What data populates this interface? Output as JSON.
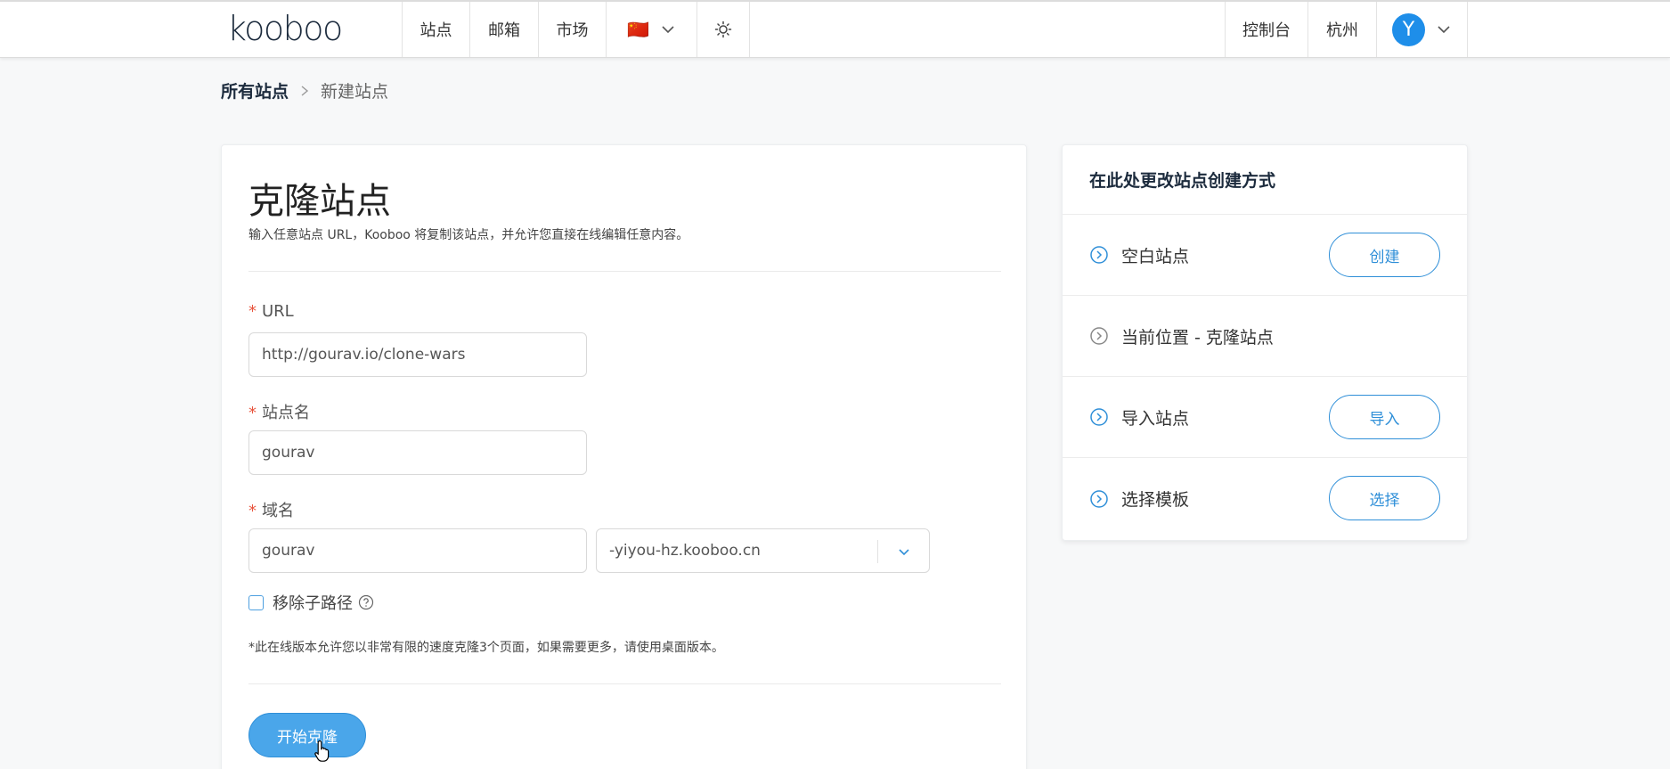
{
  "header": {
    "logo": "kooboo",
    "nav": [
      "站点",
      "邮箱",
      "市场"
    ],
    "lang_flag": "🇨🇳",
    "theme_icon": "sun-icon",
    "right_nav": [
      "控制台",
      "杭州"
    ],
    "avatar_letter": "Y"
  },
  "breadcrumb": {
    "root": "所有站点",
    "current": "新建站点"
  },
  "main": {
    "title": "克隆站点",
    "subtitle": "输入任意站点 URL，Kooboo 将复制该站点，并允许您直接在线编辑任意内容。",
    "required_mark": "*",
    "url_label": "URL",
    "url_value": "http://gourav.io/clone-wars",
    "site_name_label": "站点名",
    "site_name_value": "gourav",
    "domain_label": "域名",
    "domain_value": "gourav",
    "domain_suffix": "-yiyou-hz.kooboo.cn",
    "remove_subpath_label": "移除子路径",
    "note": "*此在线版本允许您以非常有限的速度克隆3个页面，如果需要更多，请使用桌面版本。",
    "start_button": "开始克隆"
  },
  "side": {
    "title": "在此处更改站点创建方式",
    "rows": [
      {
        "label": "空白站点",
        "button": "创建"
      },
      {
        "label": "当前位置 - 克隆站点"
      },
      {
        "label": "导入站点",
        "button": "导入"
      },
      {
        "label": "选择模板",
        "button": "选择"
      }
    ]
  },
  "colors": {
    "primary": "#2f8fd8",
    "primary_fill": "#4aa6ea",
    "required": "#e8543d",
    "avatar": "#1e8ee9"
  }
}
